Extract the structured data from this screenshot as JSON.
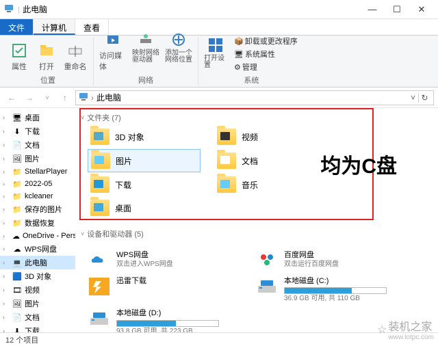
{
  "window": {
    "title": "此电脑"
  },
  "winbtns": {
    "min": "—",
    "max": "☐",
    "close": "✕"
  },
  "tabs": {
    "file": "文件",
    "computer": "计算机",
    "view": "查看"
  },
  "ribbon": {
    "props": "属性",
    "open": "打开",
    "rename": "重命名",
    "loc_group": "位置",
    "media": "访问媒体",
    "network_drive": "映射网络驱动器",
    "add_network": "添加一个网络位置",
    "net_group": "网络",
    "open_settings": "打开设置",
    "uninstall": "卸载或更改程序",
    "sys_props": "系统属性",
    "manage": "管理",
    "sys_group": "系统"
  },
  "nav": {
    "back": "←",
    "fwd": "→",
    "up": "↑",
    "drop": "˅"
  },
  "address": {
    "text": "此电脑",
    "dropdown": "˅",
    "refresh": "↻"
  },
  "sidebar": {
    "items": [
      {
        "label": "桌面",
        "icon": "desktop"
      },
      {
        "label": "下载",
        "icon": "download"
      },
      {
        "label": "文档",
        "icon": "doc"
      },
      {
        "label": "图片",
        "icon": "pic"
      },
      {
        "label": "StellarPlayer",
        "icon": "folder"
      },
      {
        "label": "2022-05",
        "icon": "folder"
      },
      {
        "label": "kcleaner",
        "icon": "folder"
      },
      {
        "label": "保存的图片",
        "icon": "folder"
      },
      {
        "label": "数据恢复",
        "icon": "folder"
      },
      {
        "label": "OneDrive - Personal",
        "icon": "onedrive"
      },
      {
        "label": "WPS网盘",
        "icon": "wps"
      },
      {
        "label": "此电脑",
        "icon": "pc",
        "sel": true
      },
      {
        "label": "3D 对象",
        "icon": "3d"
      },
      {
        "label": "视频",
        "icon": "video"
      },
      {
        "label": "图片",
        "icon": "pic"
      },
      {
        "label": "文档",
        "icon": "doc"
      },
      {
        "label": "下载",
        "icon": "download"
      }
    ]
  },
  "content": {
    "folders_header": "文件夹 (7)",
    "folders": [
      {
        "label": "3D 对象",
        "k": "3d"
      },
      {
        "label": "视频",
        "k": "vid"
      },
      {
        "label": "图片",
        "k": "pic",
        "sel": true
      },
      {
        "label": "文档",
        "k": "doc"
      },
      {
        "label": "下载",
        "k": "dl"
      },
      {
        "label": "音乐",
        "k": "mus"
      },
      {
        "label": "桌面",
        "k": "desk"
      }
    ],
    "annotation": "均为C盘",
    "drives_header": "设备和驱动器 (5)",
    "drives": [
      {
        "name": "WPS网盘",
        "sub": "双击进入WPS网盘",
        "icon": "wps"
      },
      {
        "name": "百度网盘",
        "sub": "双击运行百度网盘",
        "icon": "baidu"
      },
      {
        "name": "迅雷下载",
        "sub": "",
        "icon": "xunlei"
      },
      {
        "name": "本地磁盘 (C:)",
        "sub": "36.9 GB 可用, 共 110 GB",
        "icon": "drive",
        "fill": 66
      },
      {
        "name": "本地磁盘 (D:)",
        "sub": "93.8 GB 可用, 共 223 GB",
        "icon": "drive",
        "fill": 58
      }
    ]
  },
  "status": {
    "text": "12 个项目"
  },
  "watermark": {
    "main": "装机之家",
    "sub": "www.lotpc.com"
  }
}
